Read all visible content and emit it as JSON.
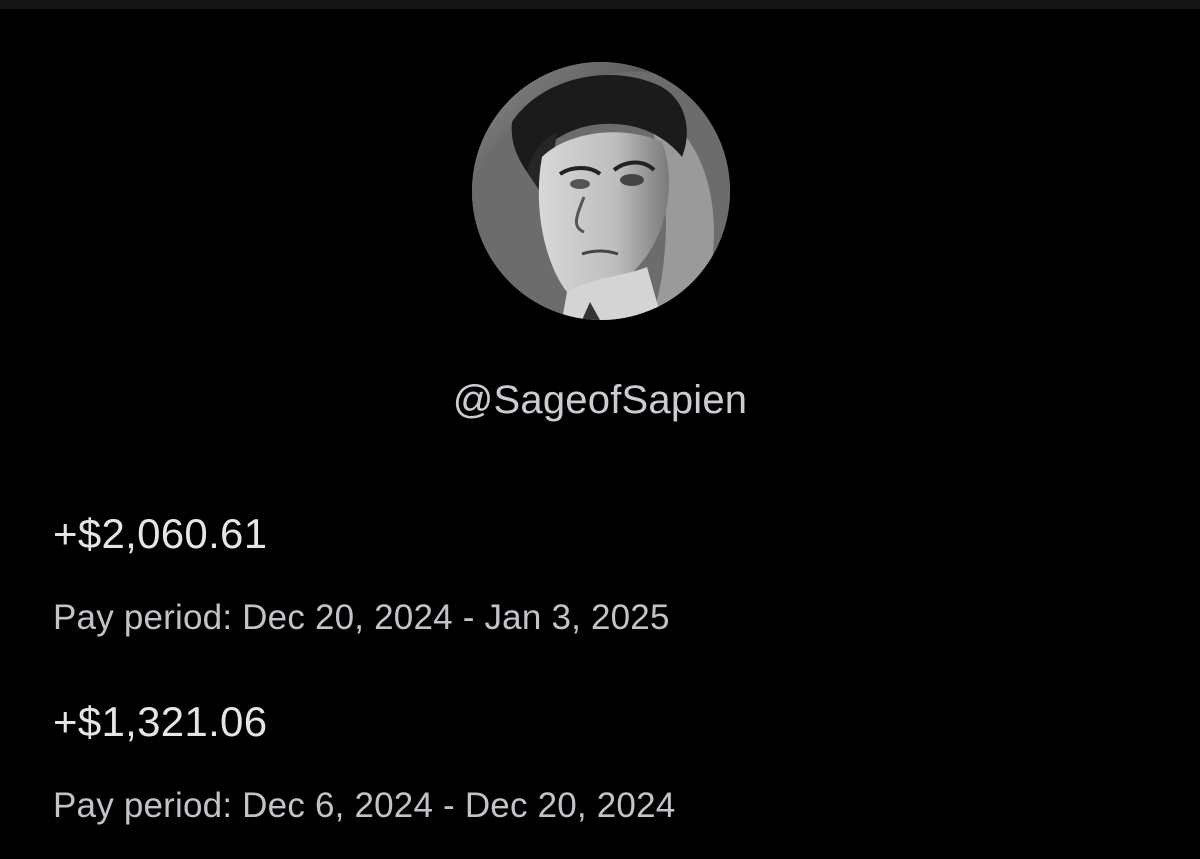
{
  "profile": {
    "avatar_icon": "profile-avatar-illustration",
    "handle": "@SageofSapien"
  },
  "payouts": [
    {
      "amount": "+$2,060.61",
      "period": "Pay period: Dec 20, 2024 - Jan 3, 2025"
    },
    {
      "amount": "+$1,321.06",
      "period": "Pay period: Dec 6, 2024 - Dec 20, 2024"
    }
  ],
  "colors": {
    "background": "#000000",
    "amount_text": "#e3e5e7",
    "secondary_text": "#c0c3c7"
  }
}
